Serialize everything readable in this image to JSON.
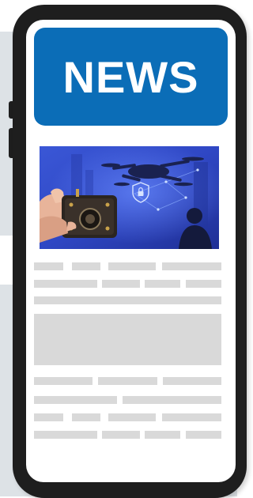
{
  "banner": {
    "title": "NEWS",
    "color": "#0b6db7"
  },
  "hero_image": {
    "subject": "drone-surveillance-with-handheld-camera-device",
    "icon": "shield-lock-icon"
  },
  "colors": {
    "placeholder": "#d9d9d9",
    "phone_frame": "#1e1e1e",
    "background_panel": "#dde2e6"
  }
}
